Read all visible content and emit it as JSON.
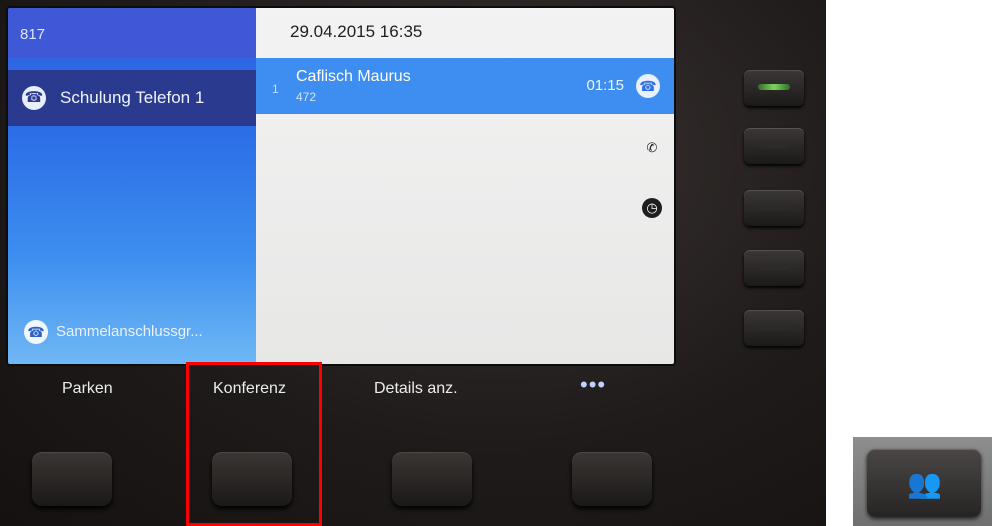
{
  "screen": {
    "line_number": "817",
    "datetime": "29.04.2015 16:35",
    "line_label": "Schulung Telefon 1",
    "hunt_group_label": "Sammelanschlussgr...",
    "call": {
      "index": "1",
      "name": "Caflisch Maurus",
      "extension": "472",
      "timer": "01:15"
    }
  },
  "softkeys": {
    "park": "Parken",
    "conference": "Konferenz",
    "details": "Details anz.",
    "more": "•••"
  },
  "icons": {
    "line": "phone-ring-icon",
    "call": "phone-ring-icon",
    "recent": "phone-icon",
    "history": "clock-icon",
    "hunt_group": "hunt-group-icon",
    "conference_key": "conference-icon"
  },
  "colors": {
    "highlight": "#ff0000",
    "active_blue": "#3d8ef0",
    "line_led_active": "#7fd45e"
  }
}
